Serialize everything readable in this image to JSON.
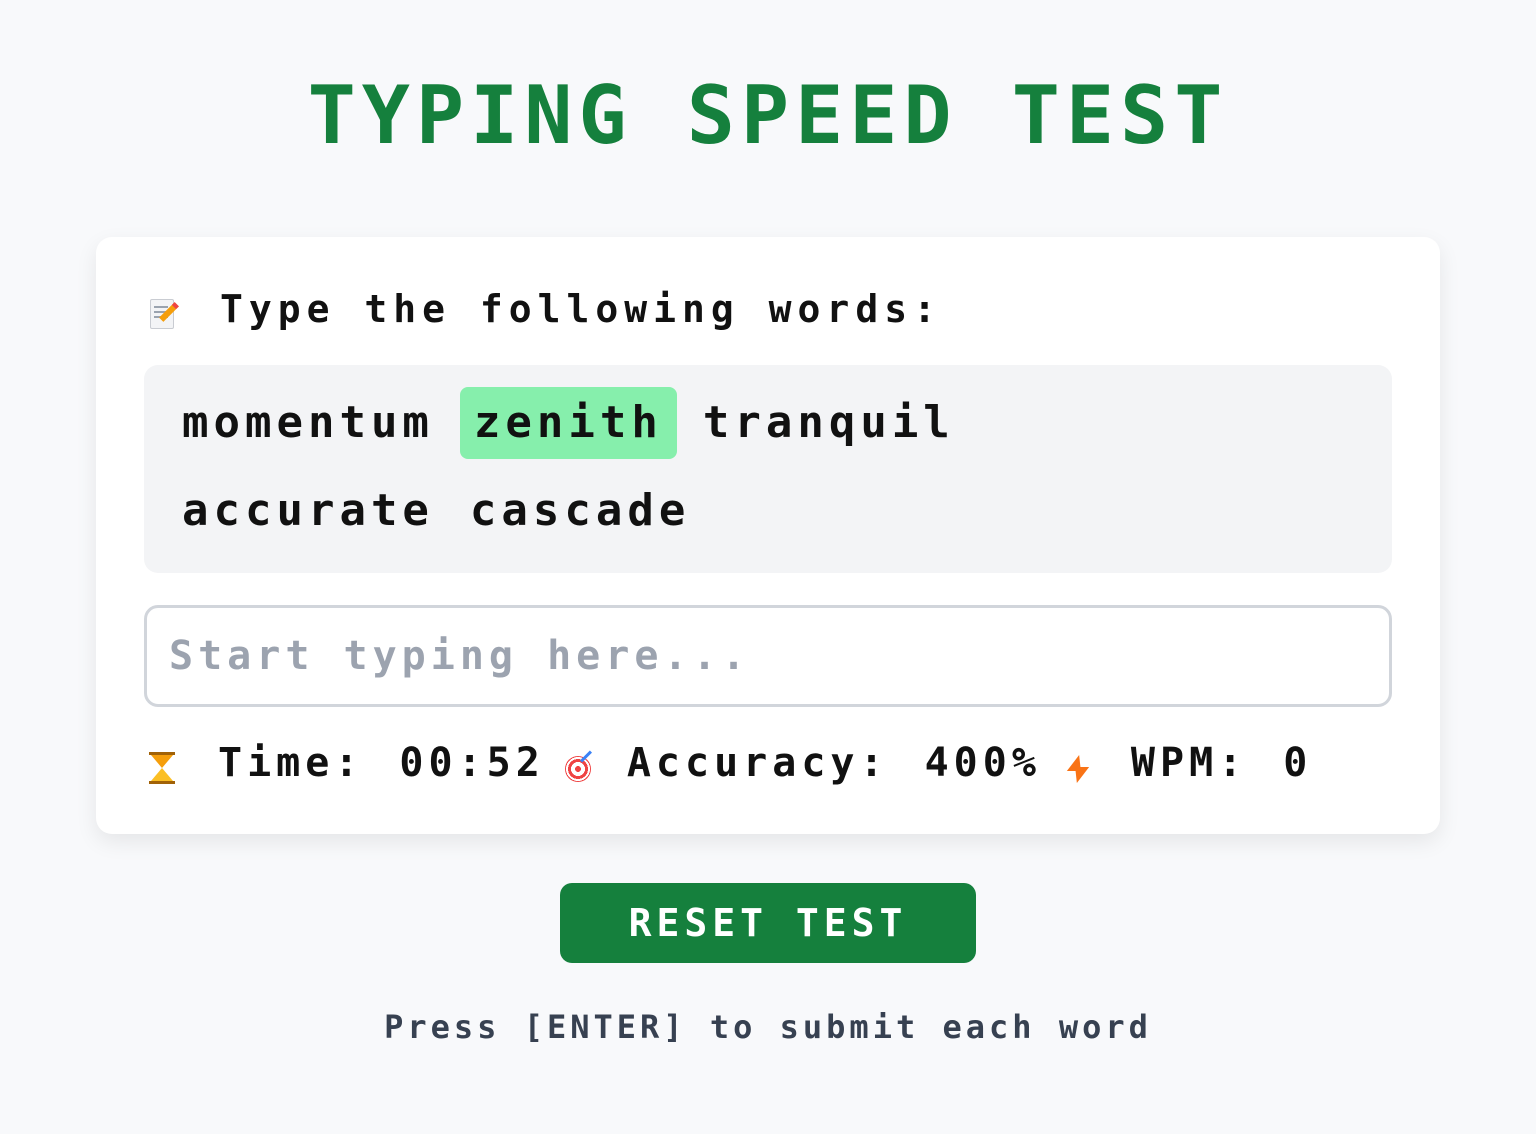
{
  "title": "TYPING SPEED TEST",
  "prompt": {
    "icon": "memo-pencil-icon",
    "text": "Type the following words:"
  },
  "words": [
    {
      "text": "momentum",
      "current": false
    },
    {
      "text": "zenith",
      "current": true
    },
    {
      "text": "tranquil",
      "current": false
    },
    {
      "text": "accurate",
      "current": false
    },
    {
      "text": "cascade",
      "current": false
    }
  ],
  "input": {
    "value": "",
    "placeholder": "Start typing here..."
  },
  "stats": {
    "time_label": "Time:",
    "time_value": "00:52",
    "time_icon": "hourglass-icon",
    "accuracy_label": "Accuracy:",
    "accuracy_value": "400%",
    "accuracy_icon": "target-icon",
    "wpm_label": "WPM:",
    "wpm_value": "0",
    "wpm_icon": "lightning-icon"
  },
  "reset_label": "RESET TEST",
  "hint": "Press [ENTER] to submit each word",
  "colors": {
    "accent": "#15803d",
    "highlight": "#86efac",
    "background": "#f8f9fb"
  }
}
